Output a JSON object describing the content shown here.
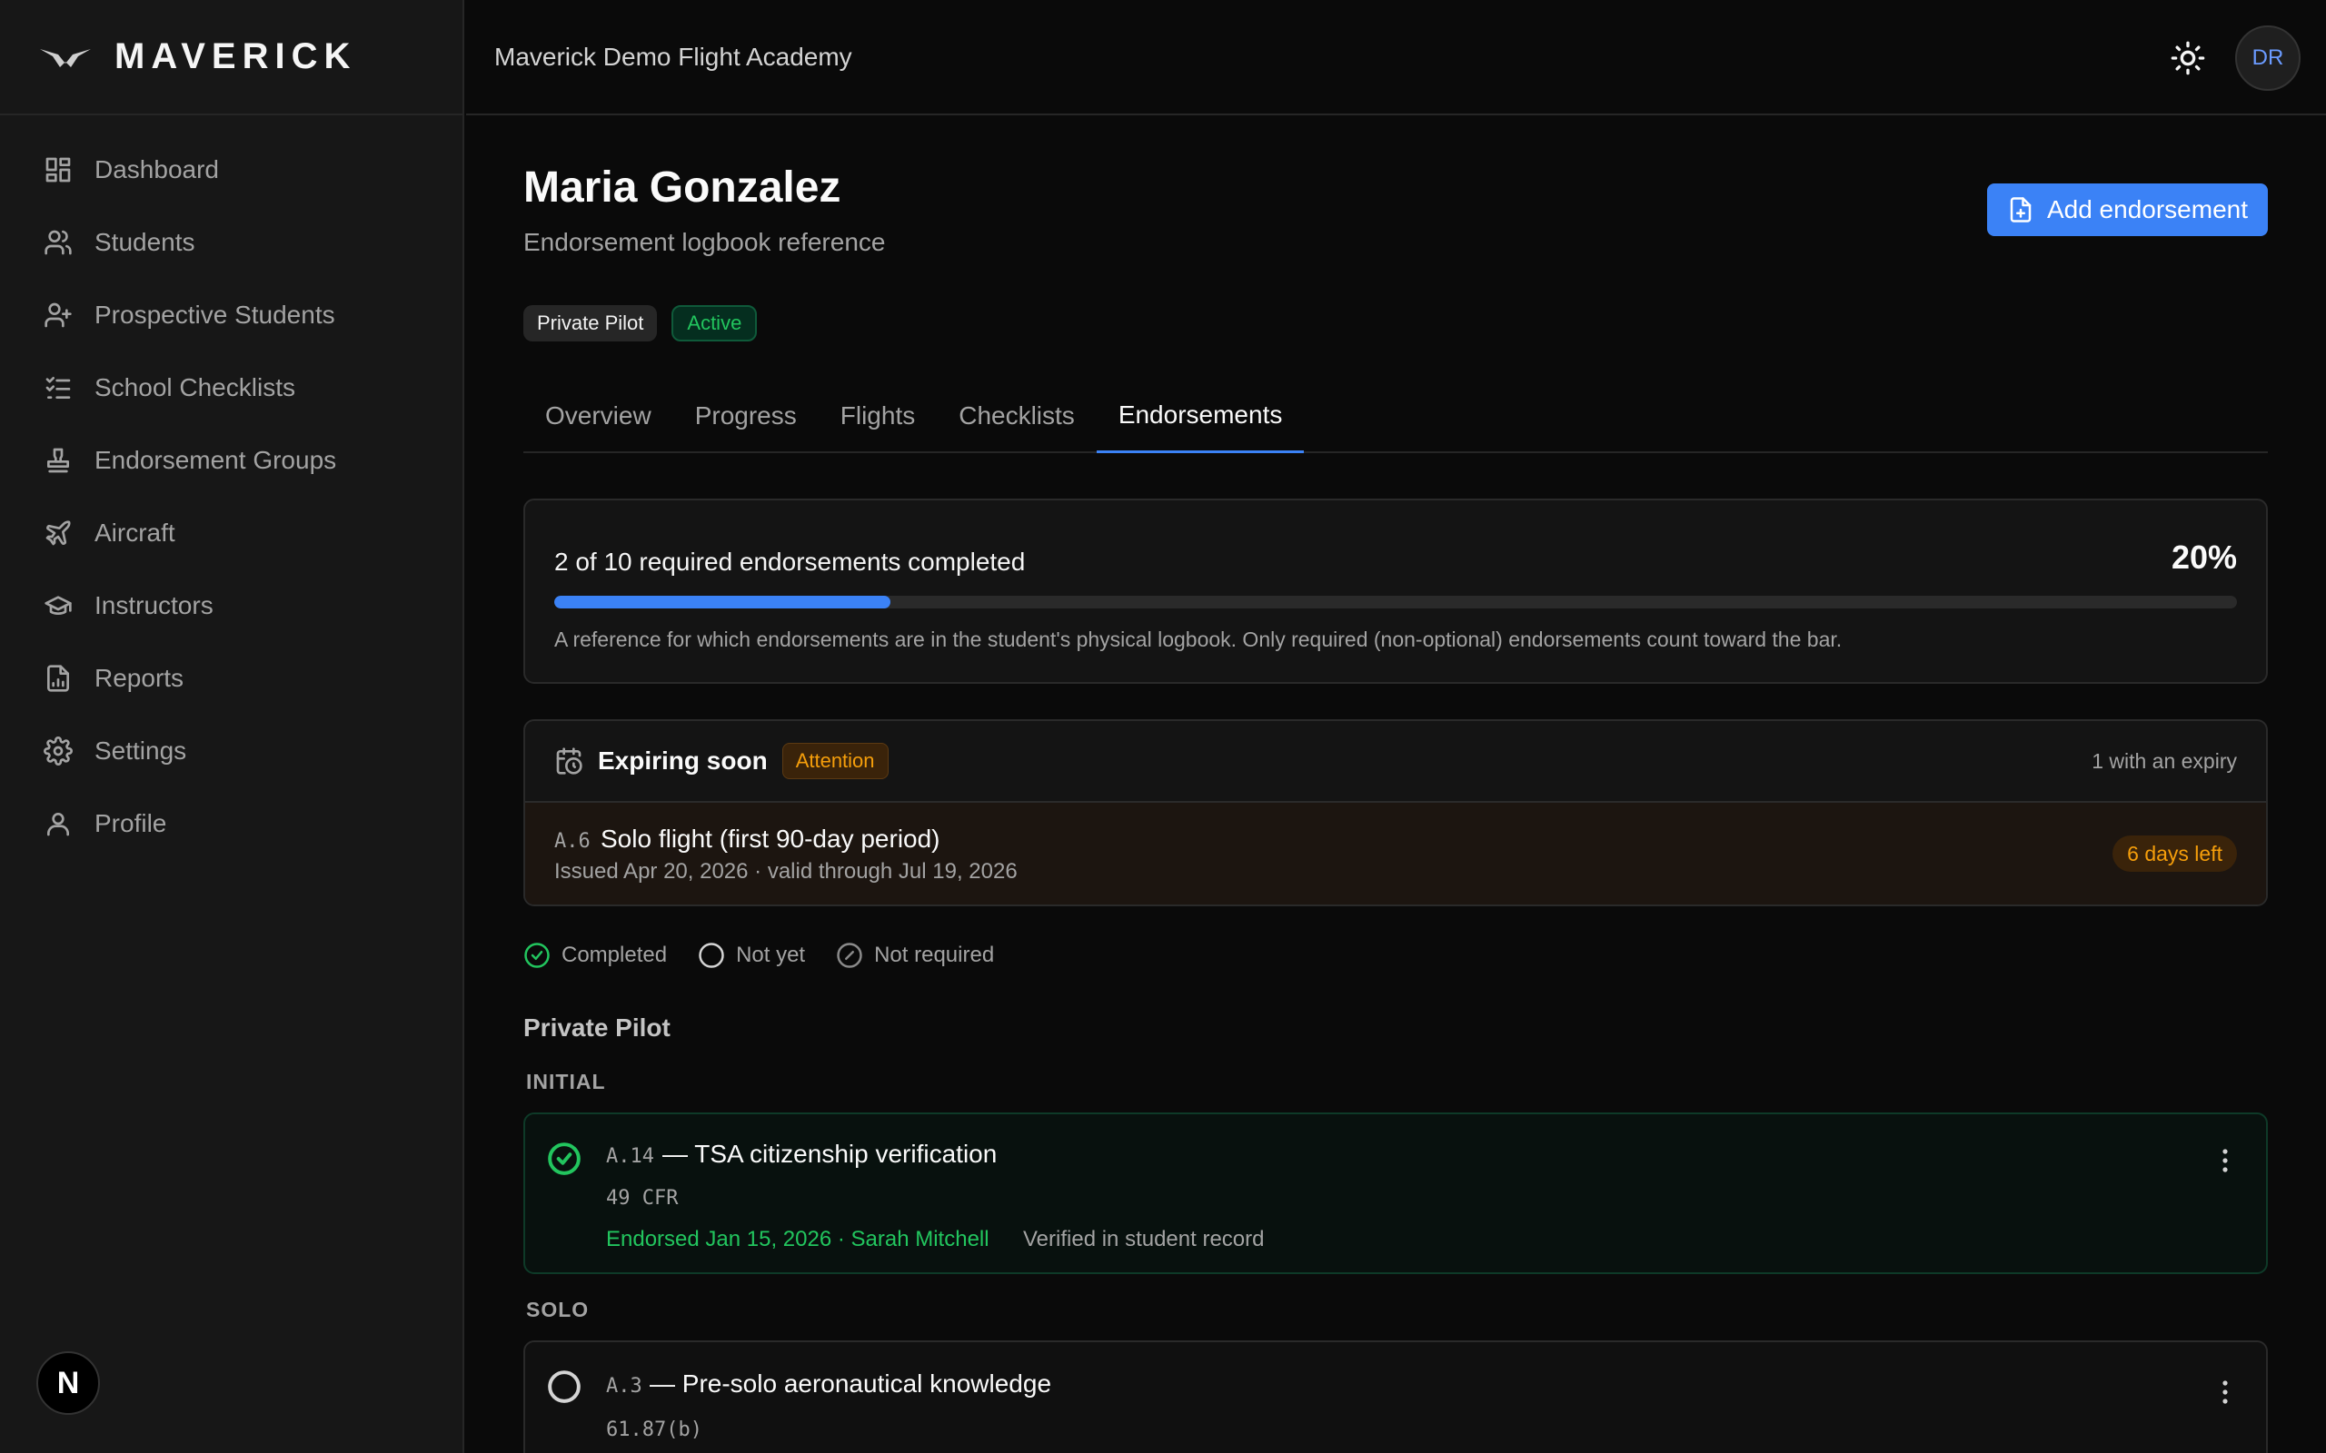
{
  "app": {
    "brand": "MAVERICK",
    "academy": "Maverick Demo Flight Academy",
    "avatar_initials": "DR",
    "dev_badge": "N"
  },
  "sidebar": {
    "items": [
      {
        "label": "Dashboard",
        "icon": "dashboard-icon"
      },
      {
        "label": "Students",
        "icon": "users-icon"
      },
      {
        "label": "Prospective Students",
        "icon": "user-plus-icon"
      },
      {
        "label": "School Checklists",
        "icon": "checklist-icon"
      },
      {
        "label": "Endorsement Groups",
        "icon": "stamp-icon"
      },
      {
        "label": "Aircraft",
        "icon": "plane-icon"
      },
      {
        "label": "Instructors",
        "icon": "graduation-cap-icon"
      },
      {
        "label": "Reports",
        "icon": "report-icon"
      },
      {
        "label": "Settings",
        "icon": "gear-icon"
      },
      {
        "label": "Profile",
        "icon": "user-icon"
      }
    ]
  },
  "student": {
    "name": "Maria Gonzalez",
    "subtitle": "Endorsement logbook reference",
    "add_button": "Add endorsement",
    "chips": {
      "program": "Private Pilot",
      "status": "Active"
    }
  },
  "tabs": [
    "Overview",
    "Progress",
    "Flights",
    "Checklists",
    "Endorsements"
  ],
  "active_tab": "Endorsements",
  "progress": {
    "label": "2 of 10 required endorsements completed",
    "percent_text": "20%",
    "fraction": 0.2,
    "note": "A reference for which endorsements are in the student's physical logbook. Only required (non-optional) endorsements count toward the bar."
  },
  "expiring": {
    "title": "Expiring soon",
    "badge": "Attention",
    "count": "1 with an expiry",
    "item": {
      "code": "A.6",
      "name": "Solo flight (first 90-day period)",
      "meta": "Issued Apr 20, 2026 · valid through Jul 19, 2026",
      "days_left": "6 days left"
    }
  },
  "legend": {
    "completed": "Completed",
    "not_yet": "Not yet",
    "not_required": "Not required"
  },
  "section": {
    "title": "Private Pilot",
    "groups": {
      "initial": {
        "label": "INITIAL",
        "item": {
          "code": "A.14",
          "name": "— TSA citizenship verification",
          "reg": "49 CFR",
          "endorsed": "Endorsed Jan 15, 2026 · Sarah Mitchell",
          "verified": "Verified in student record"
        }
      },
      "solo": {
        "label": "SOLO",
        "item": {
          "code": "A.3",
          "name": "— Pre-solo aeronautical knowledge",
          "reg": "61.87(b)"
        }
      }
    }
  },
  "colors": {
    "accent": "#3b82f6",
    "success": "#22c55e",
    "warning": "#f59e0b"
  }
}
